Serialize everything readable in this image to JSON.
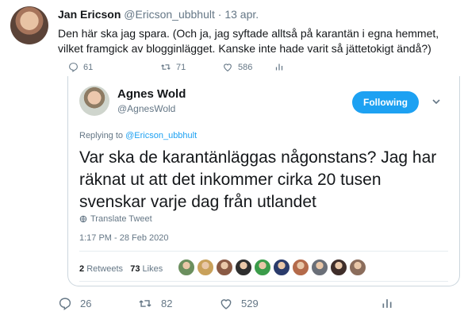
{
  "tweet": {
    "author_name": "Jan Ericson",
    "author_handle": "@Ericson_ubbhult",
    "separator": "·",
    "date": "13 apr.",
    "text": "Den här ska jag spara. (Och ja, jag syftade alltså på karantän i egna hemmet, vilket framgick av blogginlägget. Kanske inte hade varit så jättetokigt ändå?)",
    "partial_counts": {
      "replies": "61",
      "retweets": "71",
      "likes": "586"
    }
  },
  "quoted": {
    "author_name": "Agnes Wold",
    "author_handle": "@AgnesWold",
    "follow_label": "Following",
    "replying_prefix": "Replying to",
    "replying_handle": "@Ericson_ubbhult",
    "text": "Var ska de karantänläggas någonstans? Jag har räknat ut att det inkommer cirka 20 tusen svenskar varje dag från utlandet",
    "translate_label": "Translate Tweet",
    "timestamp": "1:17 PM - 28 Feb 2020",
    "retweets_count": "2",
    "retweets_label": "Retweets",
    "likes_count": "73",
    "likes_label": "Likes",
    "liker_colors": [
      "#6b8f5e",
      "#c9a15b",
      "#8a5a44",
      "#2e2e2e",
      "#3b9c4a",
      "#2a3b6b",
      "#b46a4a",
      "#6a6f78",
      "#3f2e2a",
      "#8b6d5c"
    ]
  },
  "actions": {
    "replies": "26",
    "retweets": "82",
    "likes": "529"
  },
  "colors": {
    "accent": "#1da1f2",
    "muted": "#657786",
    "border": "#ccd6dd"
  }
}
